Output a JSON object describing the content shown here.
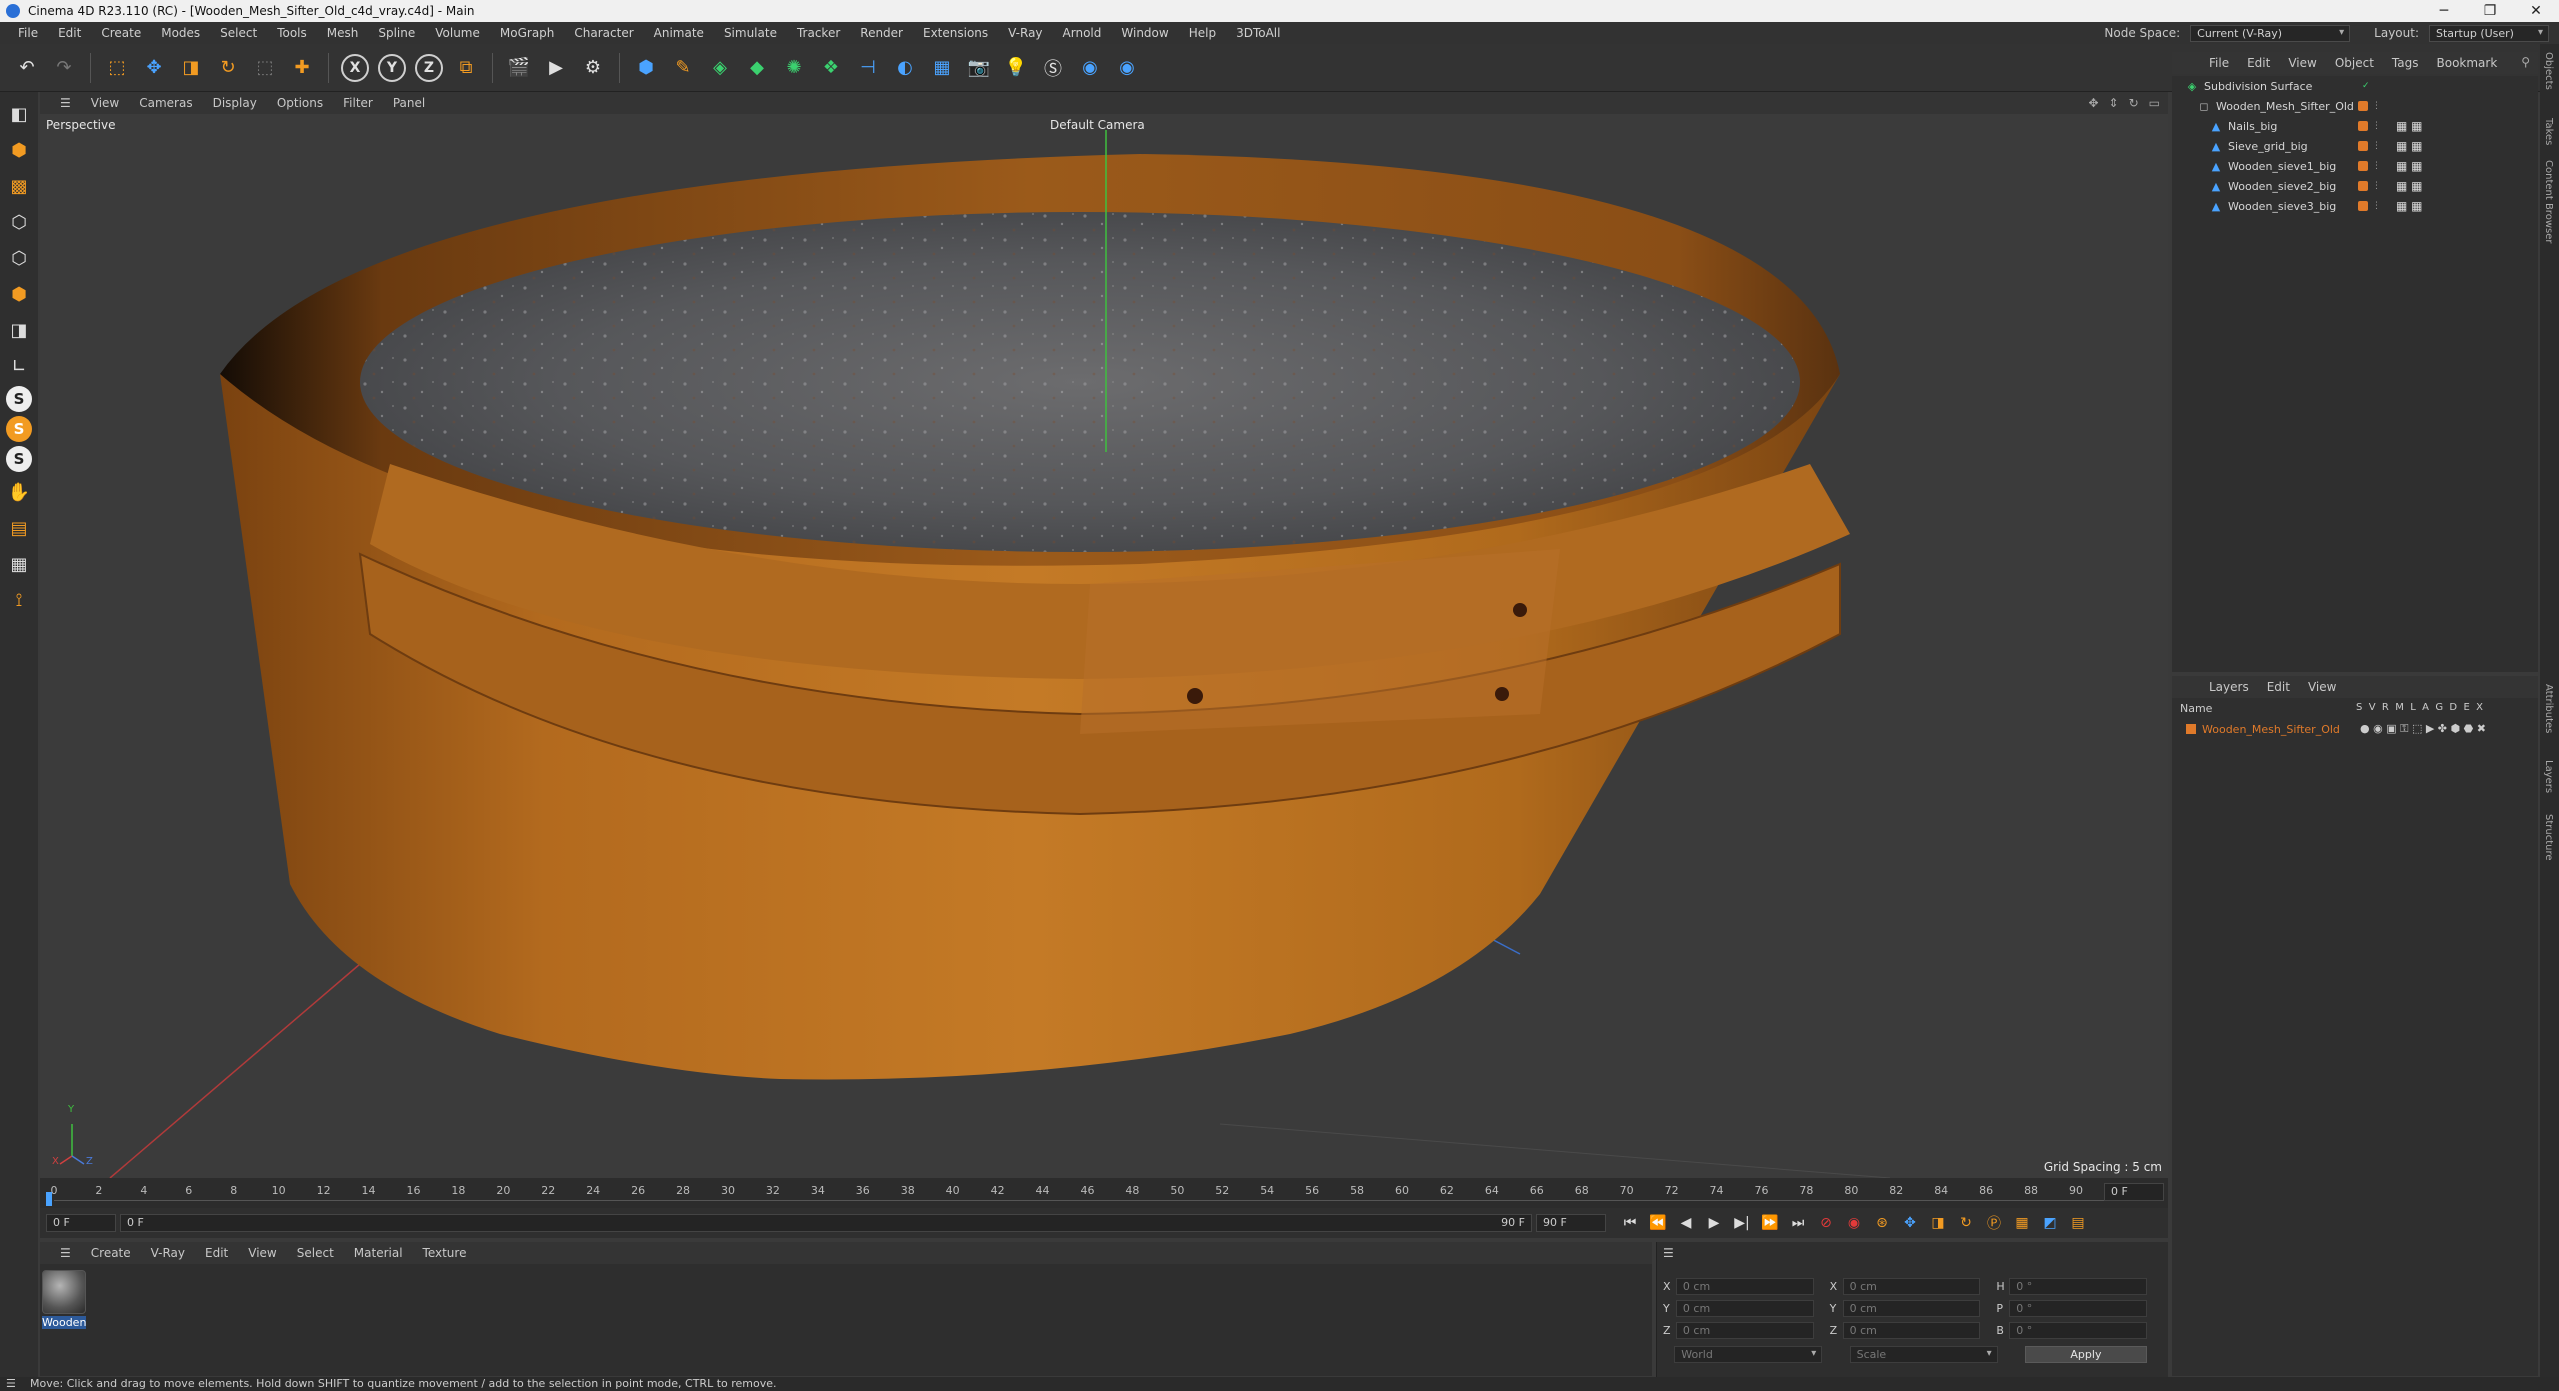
{
  "titlebar": {
    "title": "Cinema 4D R23.110 (RC) - [Wooden_Mesh_Sifter_Old_c4d_vray.c4d] - Main",
    "minimize": "─",
    "maximize": "❐",
    "close": "✕"
  },
  "menubar": {
    "items": [
      "File",
      "Edit",
      "Create",
      "Modes",
      "Select",
      "Tools",
      "Mesh",
      "Spline",
      "Volume",
      "MoGraph",
      "Character",
      "Animate",
      "Simulate",
      "Tracker",
      "Render",
      "Extensions",
      "V-Ray",
      "Arnold",
      "Window",
      "Help",
      "3DToAll"
    ],
    "node_space_label": "Node Space:",
    "node_space_value": "Current (V-Ray)",
    "layout_label": "Layout:",
    "layout_value": "Startup (User)"
  },
  "toolbar": {
    "axis_x": "X",
    "axis_y": "Y",
    "axis_z": "Z"
  },
  "viewport": {
    "menu": [
      "View",
      "Cameras",
      "Display",
      "Options",
      "Filter",
      "Panel"
    ],
    "label": "Perspective",
    "camera": "Default Camera",
    "grid_spacing": "Grid Spacing : 5 cm",
    "axis_y": "Y",
    "axis_x": "X",
    "axis_z": "Z"
  },
  "timeline": {
    "ticks": [
      "0",
      "2",
      "4",
      "6",
      "8",
      "10",
      "12",
      "14",
      "16",
      "18",
      "20",
      "22",
      "24",
      "26",
      "28",
      "30",
      "32",
      "34",
      "36",
      "38",
      "40",
      "42",
      "44",
      "46",
      "48",
      "50",
      "52",
      "54",
      "56",
      "58",
      "60",
      "62",
      "64",
      "66",
      "68",
      "70",
      "72",
      "74",
      "76",
      "78",
      "80",
      "82",
      "84",
      "86",
      "88",
      "90"
    ],
    "current_frame_right": "0 F"
  },
  "playbar": {
    "start": "0 F",
    "current": "0 F",
    "end_a": "90 F",
    "end_b": "90 F"
  },
  "materials": {
    "menu": [
      "Create",
      "V-Ray",
      "Edit",
      "View",
      "Select",
      "Material",
      "Texture"
    ],
    "items": [
      {
        "name": "Wooden"
      }
    ]
  },
  "coords": {
    "pos": [
      {
        "axis": "X",
        "value": "0 cm"
      },
      {
        "axis": "Y",
        "value": "0 cm"
      },
      {
        "axis": "Z",
        "value": "0 cm"
      }
    ],
    "size": [
      {
        "axis": "X",
        "value": "0 cm"
      },
      {
        "axis": "Y",
        "value": "0 cm"
      },
      {
        "axis": "Z",
        "value": "0 cm"
      }
    ],
    "rot": [
      {
        "axis": "H",
        "value": "0 °"
      },
      {
        "axis": "P",
        "value": "0 °"
      },
      {
        "axis": "B",
        "value": "0 °"
      }
    ],
    "space": "World",
    "mode": "Scale",
    "apply": "Apply"
  },
  "objects": {
    "menu": [
      "File",
      "Edit",
      "View",
      "Object",
      "Tags",
      "Bookmark"
    ],
    "rows": [
      {
        "name": "Subdivision Surface",
        "indent": 0
      },
      {
        "name": "Wooden_Mesh_Sifter_Old",
        "indent": 1
      },
      {
        "name": "Nails_big",
        "indent": 2
      },
      {
        "name": "Sieve_grid_big",
        "indent": 2
      },
      {
        "name": "Wooden_sieve1_big",
        "indent": 2
      },
      {
        "name": "Wooden_sieve2_big",
        "indent": 2
      },
      {
        "name": "Wooden_sieve3_big",
        "indent": 2
      }
    ]
  },
  "layers": {
    "menu": [
      "Layers",
      "Edit",
      "View"
    ],
    "name_header": "Name",
    "flag_headers": "S  V  R  M  L  A  G  D  E  X",
    "rows": [
      {
        "name": "Wooden_Mesh_Sifter_Old"
      }
    ]
  },
  "right_tabs": [
    "Objects",
    "Takes",
    "Content Browser",
    "Attributes",
    "Layers",
    "Structure"
  ],
  "status": "Move: Click and drag to move elements. Hold down SHIFT to quantize movement / add to the selection in point mode, CTRL to remove.",
  "colors": {
    "accent": "#f29b22",
    "layer_text": "#e07a2a",
    "selection": "#2d5a9a"
  }
}
